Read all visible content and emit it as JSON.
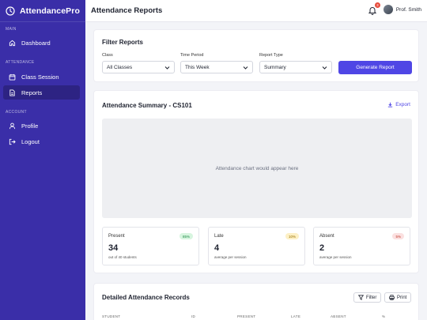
{
  "sidebar": {
    "brand": "AttendancePro",
    "sections": {
      "main": "MAIN",
      "attendance": "ATTENDANCE",
      "account": "ACCOUNT"
    },
    "items": [
      {
        "label": "Dashboard",
        "icon": "home-icon"
      },
      {
        "label": "Class Session",
        "icon": "calendar-icon"
      },
      {
        "label": "Reports",
        "icon": "document-icon",
        "active": true
      },
      {
        "label": "Profile",
        "icon": "user-icon"
      },
      {
        "label": "Logout",
        "icon": "logout-icon"
      }
    ]
  },
  "header": {
    "title": "Attendance Reports",
    "notification_count": "3",
    "user_name": "Prof. Smith"
  },
  "filter": {
    "title": "Filter Reports",
    "class_label": "Class",
    "class_value": "All Classes",
    "period_label": "Time Period",
    "period_value": "This Week",
    "type_label": "Report Type",
    "type_value": "Summary",
    "generate_label": "Generate Report"
  },
  "summary": {
    "title": "Attendance Summary - CS101",
    "export_label": "Export",
    "chart_placeholder": "Attendance chart would appear here",
    "stats": [
      {
        "label": "Present",
        "badge": "85%",
        "value": "34",
        "sub": "out of 40 students"
      },
      {
        "label": "Late",
        "badge": "10%",
        "value": "4",
        "sub": "average per session"
      },
      {
        "label": "Absent",
        "badge": "5%",
        "value": "2",
        "sub": "average per session"
      }
    ]
  },
  "records": {
    "title": "Detailed Attendance Records",
    "filter_label": "Filter",
    "print_label": "Print",
    "columns": [
      "STUDENT",
      "ID",
      "PRESENT",
      "LATE",
      "ABSENT",
      "%"
    ]
  },
  "colors": {
    "sidebar": "#3a2ea8",
    "primary": "#4f46e5",
    "present": "#1f8a46",
    "late": "#9a7000",
    "absent": "#c0392b"
  }
}
